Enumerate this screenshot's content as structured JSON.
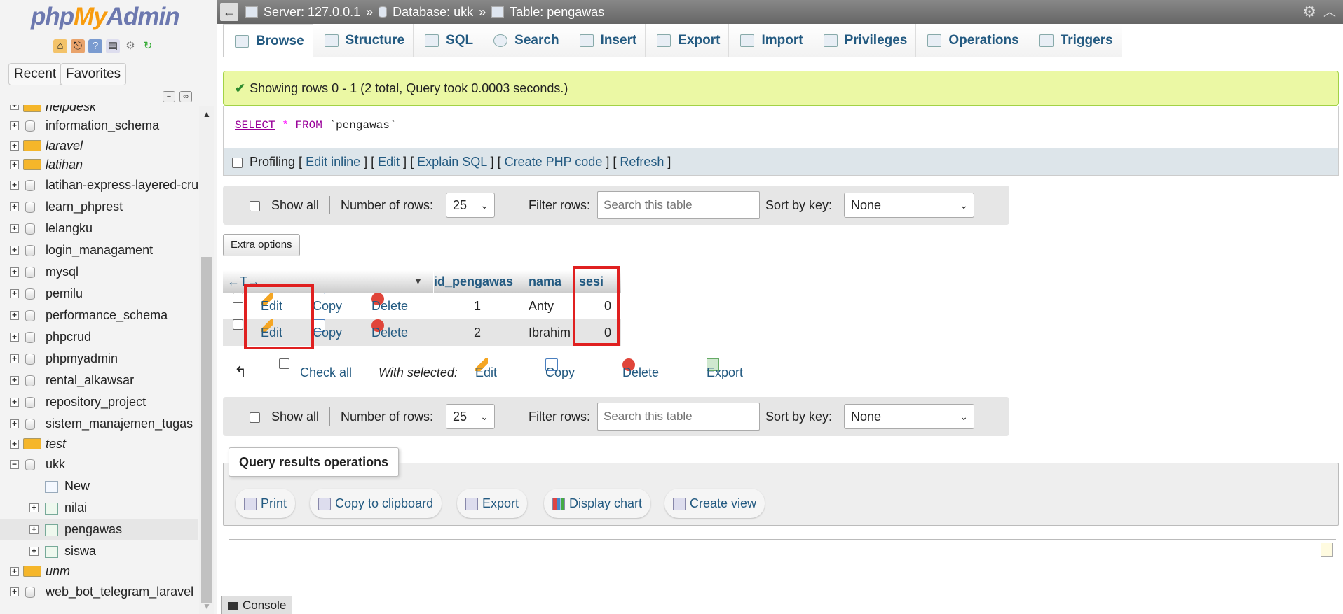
{
  "logo": {
    "part1": "php",
    "part2": "My",
    "part3": "Admin"
  },
  "nav": {
    "recent": "Recent",
    "favorites": "Favorites"
  },
  "tree": {
    "partial_top": "helpdesk",
    "databases": [
      {
        "label": "information_schema",
        "italic": false
      },
      {
        "label": "laravel",
        "italic": true
      },
      {
        "label": "latihan",
        "italic": true
      },
      {
        "label": "latihan-express-layered-crud",
        "italic": false
      },
      {
        "label": "learn_phprest",
        "italic": false
      },
      {
        "label": "lelangku",
        "italic": false
      },
      {
        "label": "login_managament",
        "italic": false
      },
      {
        "label": "mysql",
        "italic": false
      },
      {
        "label": "pemilu",
        "italic": false
      },
      {
        "label": "performance_schema",
        "italic": false
      },
      {
        "label": "phpcrud",
        "italic": false
      },
      {
        "label": "phpmyadmin",
        "italic": false
      },
      {
        "label": "rental_alkawsar",
        "italic": false
      },
      {
        "label": "repository_project",
        "italic": false
      },
      {
        "label": "sistem_manajemen_tugas",
        "italic": false
      },
      {
        "label": "test",
        "italic": true
      },
      {
        "label": "ukk",
        "italic": false
      }
    ],
    "ukk_tables": {
      "new": "New",
      "t1": "nilai",
      "t2": "pengawas",
      "t3": "siswa"
    },
    "after": [
      {
        "label": "unm",
        "italic": true
      },
      {
        "label": "web_bot_telegram_laravel",
        "italic": false
      }
    ]
  },
  "breadcrumb": {
    "server": "Server: 127.0.0.1",
    "sep": "»",
    "database": "Database: ukk",
    "table": "Table: pengawas"
  },
  "tabs": [
    "Browse",
    "Structure",
    "SQL",
    "Search",
    "Insert",
    "Export",
    "Import",
    "Privileges",
    "Operations",
    "Triggers"
  ],
  "success": {
    "text": "Showing rows 0 - 1 (2 total, Query took 0.0003 seconds.)"
  },
  "sql": {
    "select": "SELECT",
    "star": "*",
    "from": "FROM",
    "table": "`pengawas`"
  },
  "profiling": {
    "label": "Profiling",
    "edit_inline": "Edit inline",
    "edit": "Edit",
    "explain": "Explain SQL",
    "create_php": "Create PHP code",
    "refresh": "Refresh"
  },
  "navbar": {
    "show_all": "Show all",
    "num_rows_label": "Number of rows:",
    "num_rows_value": "25",
    "filter_label": "Filter rows:",
    "filter_placeholder": "Search this table",
    "sort_label": "Sort by key:",
    "sort_value": "None"
  },
  "extra_options": "Extra options",
  "table": {
    "columns": [
      "id_pengawas",
      "nama",
      "sesi"
    ],
    "action_edit": "Edit",
    "action_copy": "Copy",
    "action_delete": "Delete",
    "rows": [
      {
        "id_pengawas": "1",
        "nama": "Anty",
        "sesi": "0"
      },
      {
        "id_pengawas": "2",
        "nama": "Ibrahim",
        "sesi": "0"
      }
    ]
  },
  "with_selected": {
    "check_all": "Check all",
    "label": "With selected:",
    "edit": "Edit",
    "copy": "Copy",
    "delete": "Delete",
    "export": "Export"
  },
  "query_ops": {
    "legend": "Query results operations",
    "print": "Print",
    "copy_clipboard": "Copy to clipboard",
    "export": "Export",
    "display_chart": "Display chart",
    "create_view": "Create view"
  },
  "console": "Console"
}
